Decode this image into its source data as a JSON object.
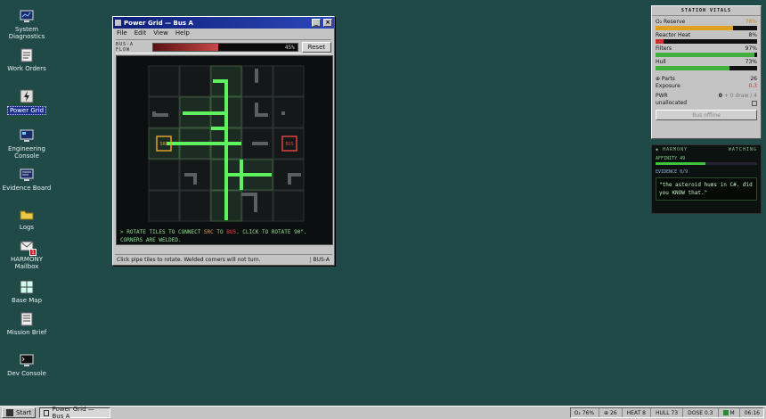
{
  "desktop_icons": [
    {
      "label": "System Diagnostics",
      "icon": "monitor-icon"
    },
    {
      "label": "Work Orders",
      "icon": "document-icon"
    },
    {
      "label": "Power Grid",
      "icon": "power-icon"
    },
    {
      "label": "Engineering Console",
      "icon": "console-icon"
    },
    {
      "label": "Evidence Board",
      "icon": "board-icon"
    },
    {
      "label": "Logs",
      "icon": "folder-icon"
    },
    {
      "label": "HARMONY Mailbox",
      "icon": "mail-icon",
      "badge": "1"
    },
    {
      "label": "Base Map",
      "icon": "map-icon"
    },
    {
      "label": "Mission Brief",
      "icon": "brief-icon"
    },
    {
      "label": "Dev Console",
      "icon": "dev-icon"
    }
  ],
  "window": {
    "title": "Power Grid — Bus A",
    "menu": [
      "File",
      "Edit",
      "View",
      "Help"
    ],
    "flow_label": "BUS-A FLOW",
    "flow_value": "45%",
    "flow_fraction": 0.45,
    "reset_label": "Reset",
    "console_parts": [
      "> ROTATE TILES TO CONNECT ",
      "SRC",
      " TO ",
      "BUS",
      ". CLICK TO ROTATE 90°. CORNERS ARE WELDED."
    ],
    "status_main": "Click pipe tiles to rotate. Welded corners will not turn.",
    "status_right": "BUS-A",
    "src_label": "SRC",
    "bus_label": "BUS"
  },
  "vitals": {
    "title": "STATION VITALS",
    "rows": [
      {
        "label": "O₂ Reserve",
        "value": "76%",
        "fraction": 0.76,
        "color": "#e0a020",
        "tone": "orange"
      },
      {
        "label": "Reactor Heat",
        "value": "8%",
        "fraction": 0.08,
        "color": "#cc3030",
        "tone": ""
      },
      {
        "label": "Filters",
        "value": "97%",
        "fraction": 0.97,
        "color": "#40b040",
        "tone": ""
      },
      {
        "label": "Hull",
        "value": "73%",
        "fraction": 0.73,
        "color": "#40b040",
        "tone": ""
      }
    ],
    "parts_label": "⊕ Parts",
    "parts_value": "26",
    "exposure_label": "Exposure",
    "exposure_value": "0.3",
    "pwr_label": "PWR",
    "pwr_value": "0",
    "pwr_extra": "+ 0 draw / 4",
    "unalloc_label": "unallocated",
    "bus_button": "Bus offline"
  },
  "harmony": {
    "title": "◆ HARMONY",
    "state": "WATCHING",
    "affinity": "AFFINITY 49",
    "affinity_fraction": 0.49,
    "evidence": "EVIDENCE 0/9",
    "quote": "\"the asteroid hums in C#. did you KNOW that.\""
  },
  "taskbar": {
    "start": "Start",
    "task": "Power Grid — Bus A",
    "o2": "O₂ 76%",
    "parts": "⊕ 26",
    "heat": "HEAT 8",
    "hull": "HULL 73",
    "dose": "DOSE 0.3",
    "m": "M",
    "clock": "06:16"
  }
}
